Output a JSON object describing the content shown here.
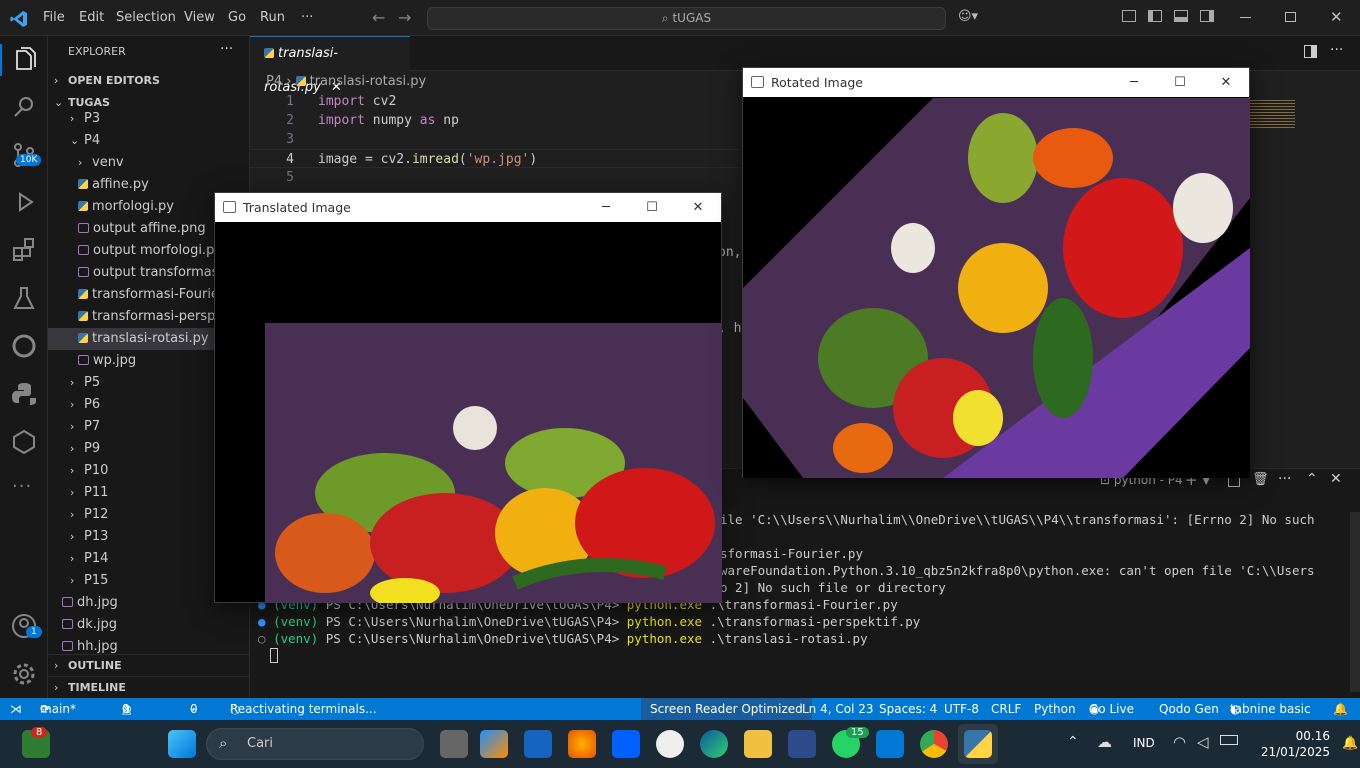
{
  "menu": [
    "File",
    "Edit",
    "Selection",
    "View",
    "Go",
    "Run",
    "···"
  ],
  "command_center": "tUGAS",
  "activity": {
    "badge_remote": "10K",
    "badge_account": "1"
  },
  "explorer": {
    "title": "EXPLORER",
    "open_editors": "OPEN EDITORS",
    "root": "TUGAS",
    "items": [
      {
        "label": "P3",
        "kind": "folder"
      },
      {
        "label": "P4",
        "kind": "folder-open"
      },
      {
        "label": "venv",
        "kind": "folder"
      },
      {
        "label": "affine.py",
        "kind": "py"
      },
      {
        "label": "morfologi.py",
        "kind": "py"
      },
      {
        "label": "output affine.png",
        "kind": "img"
      },
      {
        "label": "output morfologi.png",
        "kind": "img"
      },
      {
        "label": "output transformasi-p",
        "kind": "img"
      },
      {
        "label": "transformasi-Fourier.p",
        "kind": "py"
      },
      {
        "label": "transformasi-perspekt",
        "kind": "py"
      },
      {
        "label": "translasi-rotasi.py",
        "kind": "py"
      },
      {
        "label": "wp.jpg",
        "kind": "img"
      },
      {
        "label": "P5",
        "kind": "folder"
      },
      {
        "label": "P6",
        "kind": "folder"
      },
      {
        "label": "P7",
        "kind": "folder"
      },
      {
        "label": "P9",
        "kind": "folder"
      },
      {
        "label": "P10",
        "kind": "folder"
      },
      {
        "label": "P11",
        "kind": "folder"
      },
      {
        "label": "P12",
        "kind": "folder"
      },
      {
        "label": "P13",
        "kind": "folder"
      },
      {
        "label": "P14",
        "kind": "folder"
      },
      {
        "label": "P15",
        "kind": "folder"
      },
      {
        "label": "dh.jpg",
        "kind": "img"
      },
      {
        "label": "dk.jpg",
        "kind": "img"
      },
      {
        "label": "hh.jpg",
        "kind": "img"
      }
    ],
    "outline": "OUTLINE",
    "timeline": "TIMELINE"
  },
  "editor": {
    "tab": "translasi-rotasi.py",
    "breadcrumb": {
      "folder": "P4",
      "file": "translasi-rotasi.py"
    },
    "lines": [
      {
        "n": "1",
        "k": "import",
        "r": " cv2"
      },
      {
        "n": "2",
        "k": "import",
        "r": " numpy ",
        "k2": "as",
        "r2": " np"
      },
      {
        "n": "3"
      },
      {
        "n": "4",
        "v": "image",
        "eq": " = cv2.",
        "f": "imread",
        "p": "(",
        "s": "'wp.jpg'",
        "pe": ")"
      },
      {
        "n": "5"
      }
    ],
    "fragments": [
      "on,",
      ", h"
    ]
  },
  "terminal": {
    "title": "python - P4",
    "lines": [
      "ile 'C:\\\\Users\\\\Nurhalim\\\\OneDrive\\\\tUGAS\\\\P4\\\\transformasi': [Errno 2] No such",
      "",
      "sformasi-Fourier.py",
      "wareFoundation.Python.3.10_qbz5n2kfra8p0\\python.exe: can't open file 'C:\\\\Users",
      "o 2] No such file or directory"
    ],
    "prompts": [
      {
        "venv": "(venv)",
        "path": " PS C:\\Users\\Nurhalim\\OneDrive\\tUGAS\\P4> ",
        "cmd": "python.exe",
        "arg": " .\\transformasi-Fourier.py"
      },
      {
        "venv": "(venv)",
        "path": " PS C:\\Users\\Nurhalim\\OneDrive\\tUGAS\\P4> ",
        "cmd": "python.exe",
        "arg": " .\\transformasi-perspektif.py"
      },
      {
        "venv": "(venv)",
        "path": " PS C:\\Users\\Nurhalim\\OneDrive\\tUGAS\\P4> ",
        "cmd": "python.exe",
        "arg": " .\\translasi-rotasi.py"
      }
    ]
  },
  "status": {
    "branch": "main*",
    "errors": "0",
    "warnings": "0",
    "ports": "0",
    "task": "Reactivating terminals...",
    "screen_reader": "Screen Reader Optimized",
    "position": "Ln 4, Col 23",
    "spaces": "Spaces: 4",
    "encoding": "UTF-8",
    "eol": "CRLF",
    "language": "Python",
    "golive": "Go Live",
    "qodo": "Qodo Gen",
    "tabnine": "tabnine basic"
  },
  "windows": {
    "translated": "Translated Image",
    "rotated": "Rotated Image"
  },
  "taskbar": {
    "search": "Cari",
    "badge_widgets": "8",
    "badge_whatsapp": "15",
    "lang": "IND",
    "time": "00.16",
    "date": "21/01/2025"
  }
}
